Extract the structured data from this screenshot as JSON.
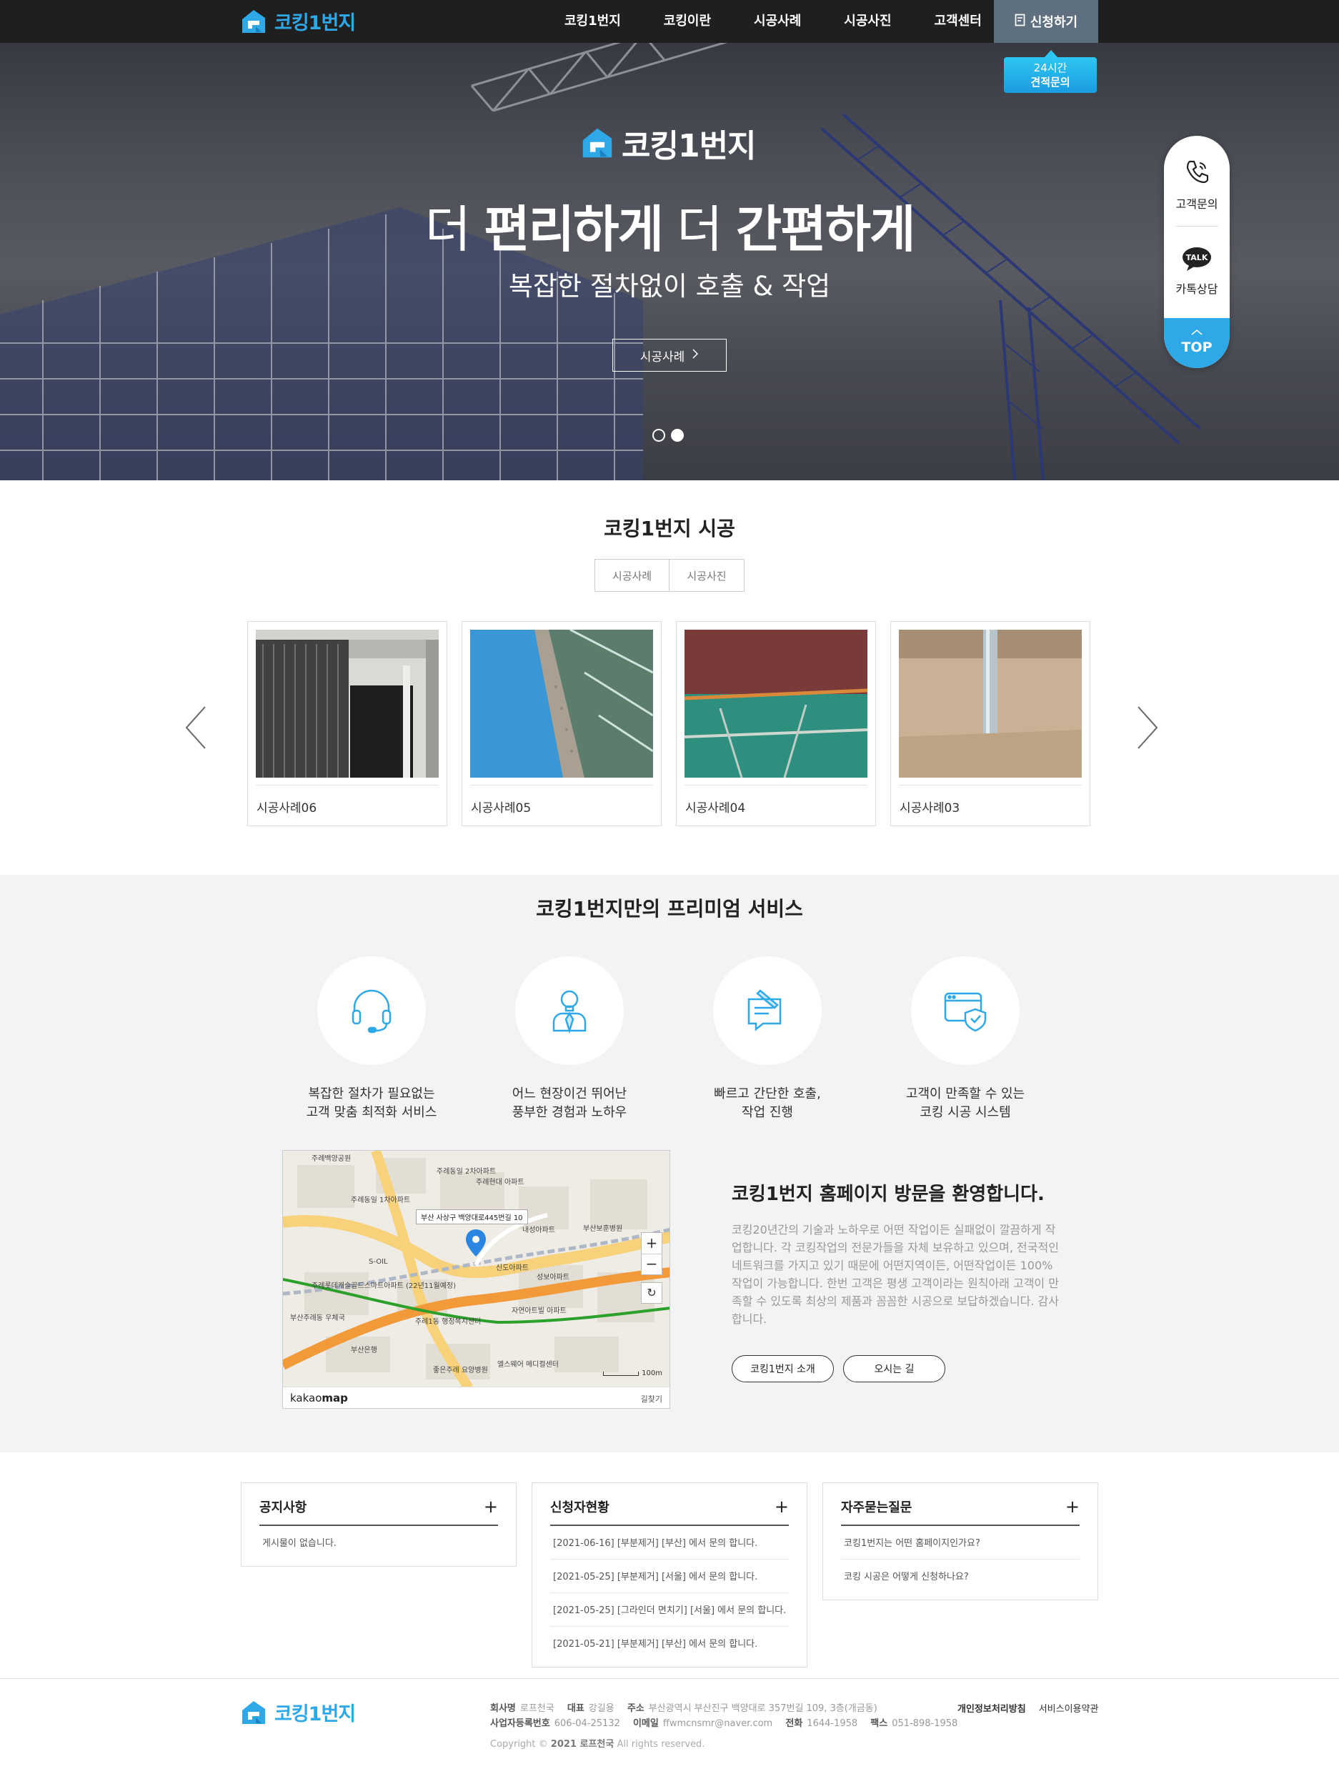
{
  "brand": {
    "name": "코킹1번지",
    "color": "#2fa8e8"
  },
  "nav": {
    "menu": [
      "코킹1번지",
      "코킹이란",
      "시공사례",
      "시공사진",
      "고객센터"
    ],
    "apply_label": "신청하기",
    "quote_badge": {
      "line1": "24시간",
      "line2": "견적문의"
    }
  },
  "hero": {
    "logo_text": "코킹1번지",
    "title_a": "더 ",
    "title_b": "편리하게",
    "title_c": " 더 ",
    "title_d": "간편하게",
    "subtitle": "복잡한 절차없이 호출 & 작업",
    "button_label": "시공사례",
    "slides": 2,
    "active_slide": 2
  },
  "quick_menu": {
    "call_label": "고객문의",
    "talk_badge": "TALK",
    "talk_label": "카톡상담",
    "top_label": "TOP"
  },
  "works": {
    "title": "코킹1번지 시공",
    "tabs": [
      "시공사례",
      "시공사진"
    ],
    "cards": [
      {
        "caption": "시공사례06",
        "icon": "window-photo"
      },
      {
        "caption": "시공사례05",
        "icon": "blue-roof-photo"
      },
      {
        "caption": "시공사례04",
        "icon": "red-wall-photo"
      },
      {
        "caption": "시공사례03",
        "icon": "pipe-photo"
      }
    ]
  },
  "premium": {
    "title": "코킹1번지만의 프리미엄 서비스",
    "services": [
      {
        "line1": "복잡한 절차가 필요없는",
        "line2": "고객 맞춤 최적화 서비스",
        "icon": "headset-icon"
      },
      {
        "line1": "어느 현장이건 뛰어난",
        "line2": "풍부한 경험과 노하우",
        "icon": "expert-icon"
      },
      {
        "line1": "빠르고 간단한 호출,",
        "line2": "작업 진행",
        "icon": "request-form-icon"
      },
      {
        "line1": "고객이 만족할 수 있는",
        "line2": "코킹 시공 시스템",
        "icon": "shield-check-icon"
      }
    ]
  },
  "map": {
    "address_label": "부산 사상구 백양대로445번길 10",
    "logo_a": "kakao",
    "logo_b": "map",
    "route_label": "길찾기",
    "scale_label": "100m",
    "zoom_in": "+",
    "zoom_out": "−",
    "place_labels": [
      "주례동일 2차아파트",
      "주례현대 아파트",
      "주례동일 1차아파트",
      "S-OIL",
      "내성아파트",
      "부산보훈병원",
      "성보아파트",
      "신도아파트",
      "부산주례동 우체국",
      "주례1동 행정복지센터",
      "자연아트빌 아파트",
      "좋은주례 요양병원",
      "엘스웨어 메디컬센터",
      "부산은행",
      "주례롯데캐슬골드스마트아파트 (22년11월예정)",
      "주례백양공원"
    ]
  },
  "welcome": {
    "title": "코킹1번지 홈페이지 방문을 환영합니다.",
    "text": "코킹20년간의 기술과 노하우로 어떤 작업이든 실패없이 깔끔하게 작업합니다. 각 코킹작업의 전문가들을 자체 보유하고 있으며, 전국적인 네트워크를 가지고 있기 때문에 어떤지역이든, 어떤작업이든 100% 작업이 가능합니다. 한번 고객은 평생 고객이라는 원칙아래 고객이 만족할 수 있도록 최상의 제품과 꼼꼼한 시공으로 보답하겠습니다. 감사합니다.",
    "btn_intro": "코킹1번지 소개",
    "btn_route": "오시는 길"
  },
  "boards": {
    "notice": {
      "title": "공지사항",
      "rows": [
        "게시물이 없습니다."
      ]
    },
    "applicants": {
      "title": "신청자현황",
      "rows": [
        "[2021-06-16] [부분제거] [부산] 에서 문의 합니다.",
        "[2021-05-25] [부분제거] [서울] 에서 문의 합니다.",
        "[2021-05-25] [그라인더 면치기] [서울] 에서 문의 합니다.",
        "[2021-05-21] [부분제거] [부산] 에서 문의 합니다."
      ]
    },
    "faq": {
      "title": "자주묻는질문",
      "rows": [
        "코킹1번지는 어떤 홈페이지인가요?",
        "코킹 시공은 어떻게 신청하나요?"
      ]
    }
  },
  "footer": {
    "company_label": "회사명",
    "company": "로프천국",
    "ceo_label": "대표",
    "ceo": "강길용",
    "address_label": "주소",
    "address": "부산광역시 부산진구 백양대로 357번길 109, 3층(개금동)",
    "bizno_label": "사업자등록번호",
    "bizno": "606-04-25132",
    "email_label": "이메일",
    "email": "ffwmcnsmr@naver.com",
    "tel_label": "전화",
    "tel": "1644-1958",
    "fax_label": "팩스",
    "fax": "051-898-1958",
    "copyright_a": "Copyright © ",
    "copyright_b": "2021 로프천국",
    "copyright_c": " All rights reserved.",
    "privacy": "개인정보처리방침",
    "terms": "서비스이용약관"
  }
}
